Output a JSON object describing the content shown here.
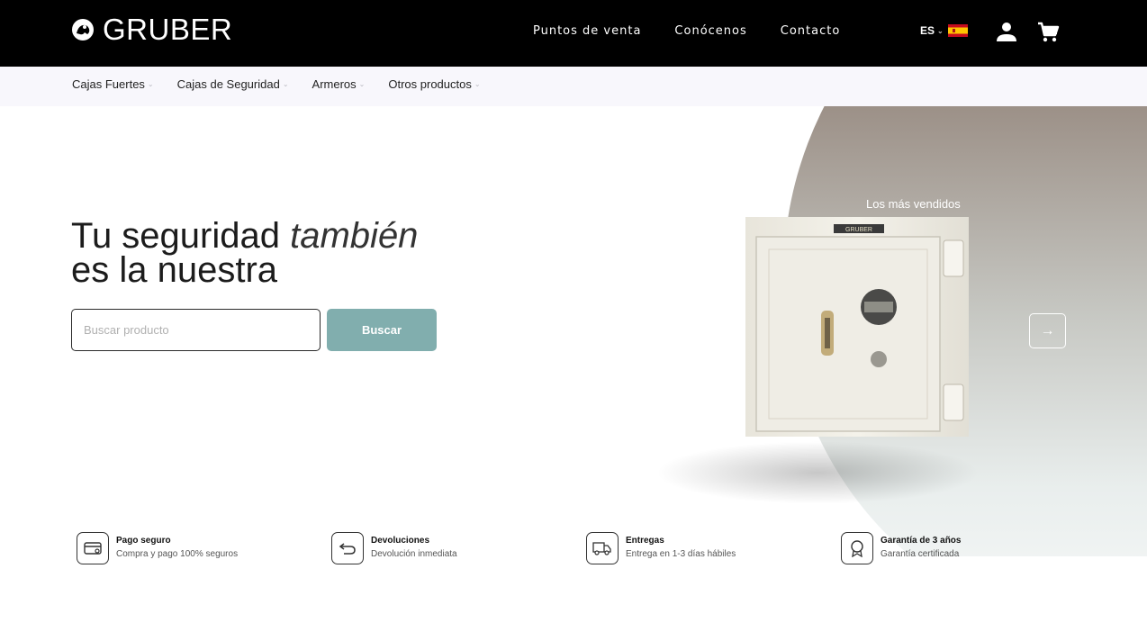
{
  "header": {
    "logo_text": "GRUBER",
    "nav": [
      {
        "label": "Puntos de venta"
      },
      {
        "label": "Conócenos"
      },
      {
        "label": "Contacto"
      }
    ],
    "language": "ES",
    "flag_colors": {
      "red": "#c60b1e",
      "yellow": "#ffc400"
    }
  },
  "categories": [
    {
      "label": "Cajas Fuertes"
    },
    {
      "label": "Cajas de Seguridad"
    },
    {
      "label": "Armeros"
    },
    {
      "label": "Otros productos"
    }
  ],
  "hero": {
    "title_part1": "Tu seguridad",
    "title_emphasis": "también",
    "title_part2": "es la nuestra",
    "search_placeholder": "Buscar producto",
    "search_value": "",
    "search_button": "Buscar",
    "carousel_label": "Los más vendidos",
    "carousel_next": "→",
    "product_plate_text": "GRUBER"
  },
  "features": [
    {
      "icon": "credit-card-icon",
      "title": "Pago seguro",
      "subtitle": "Compra y pago 100% seguros"
    },
    {
      "icon": "return-arrow-icon",
      "title": "Devoluciones",
      "subtitle": "Devolución inmediata"
    },
    {
      "icon": "delivery-truck-icon",
      "title": "Entregas",
      "subtitle": "Entrega en 1-3 días hábiles"
    },
    {
      "icon": "award-badge-icon",
      "title": "Garantía de 3 años",
      "subtitle": "Garantía certificada"
    }
  ],
  "colors": {
    "header_bg": "#000000",
    "category_bar_bg": "#f8f7fc",
    "accent_button": "#81aeae",
    "hero_gradient_top": "#7f6c5d"
  }
}
